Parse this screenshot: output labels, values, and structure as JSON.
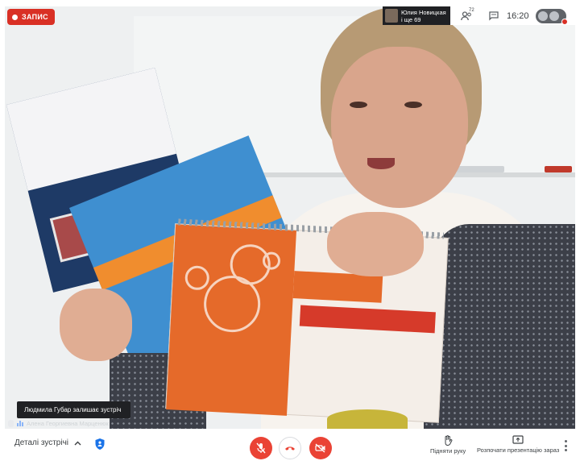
{
  "recording": {
    "label": "ЗАПИС"
  },
  "presenter": {
    "name": "Юлия Новицкая",
    "others": "і ще 69"
  },
  "topbar": {
    "participants_badge": "72",
    "time": "16:20"
  },
  "toast": {
    "message": "Людмила Губар залишає зустріч"
  },
  "participant": {
    "name": "Алена Георгиевна Марценюк"
  },
  "bottombar": {
    "meeting_details": "Деталі зустрічі",
    "raise_hand": "Підняти руку",
    "present_now": "Розпочати презентацію зараз"
  },
  "colors": {
    "record_red": "#d93025",
    "control_red": "#ea4335",
    "toolbar_bg": "#ffffff",
    "dark_chip": "#202124"
  },
  "icons": {
    "people": "people-icon",
    "chat": "chat-icon",
    "mic_off": "mic-off-icon",
    "hangup": "hangup-icon",
    "camera_off": "camera-off-icon",
    "hand": "hand-icon",
    "present": "present-icon",
    "shield": "shield-icon",
    "more": "more-vert-icon"
  }
}
